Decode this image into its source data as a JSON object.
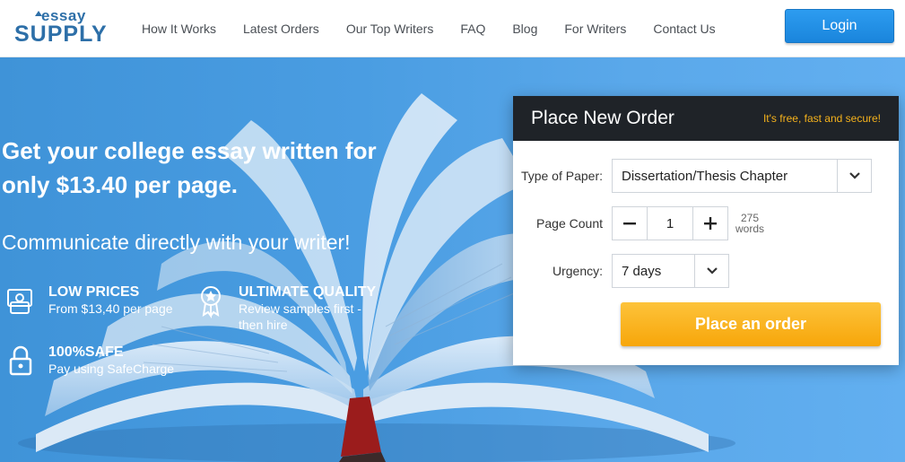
{
  "header": {
    "logo_top": "essay",
    "logo_bottom": "SUPPLY",
    "nav": [
      "How It Works",
      "Latest Orders",
      "Our Top Writers",
      "FAQ",
      "Blog",
      "For Writers",
      "Contact Us"
    ],
    "login_label": "Login"
  },
  "hero": {
    "headline": "Get your college essay written for only $13.40 per page.",
    "subline": "Communicate directly with your writer!",
    "features": [
      {
        "title": "LOW PRICES",
        "desc": "From $13,40 per page",
        "icon": "money-icon"
      },
      {
        "title": "ULTIMATE QUALITY",
        "desc": "Review samples first - then hire",
        "icon": "award-badge-icon"
      },
      {
        "title": "100%SAFE",
        "desc": "Pay using SafeCharge",
        "icon": "lock-icon"
      }
    ]
  },
  "order": {
    "title": "Place New Order",
    "tagline": "It's free, fast and secure!",
    "type_label": "Type of Paper:",
    "type_value": "Dissertation/Thesis Chapter",
    "pages_label": "Page Count",
    "pages_value": "1",
    "words_count": "275",
    "words_label": "words",
    "urgency_label": "Urgency:",
    "urgency_value": "7 days",
    "submit_label": "Place an order"
  },
  "colors": {
    "accent": "#1a85dc",
    "cta": "#f7a60a",
    "hero_bg": "#4a9de2",
    "panel_head": "#1f2328",
    "tag": "#f5b21c"
  }
}
